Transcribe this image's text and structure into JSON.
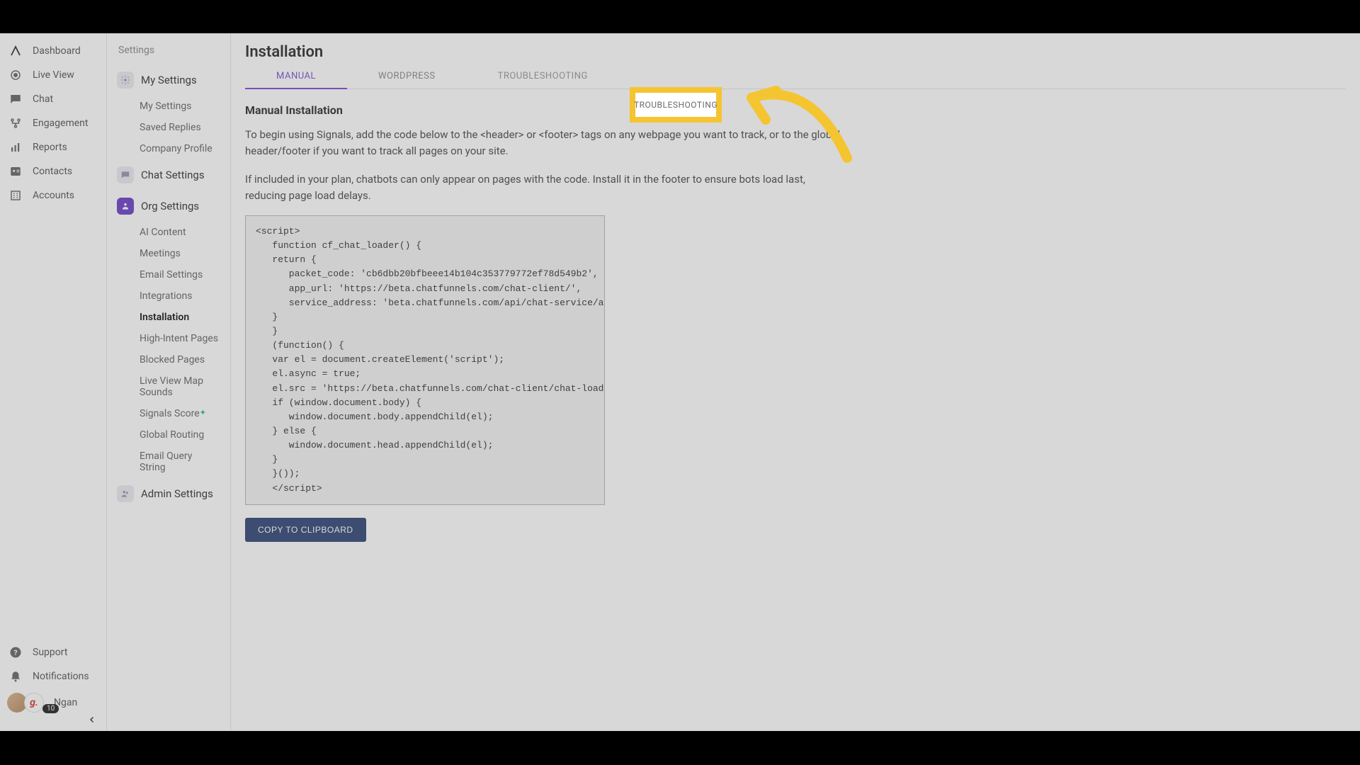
{
  "left_nav": {
    "items": [
      {
        "label": "Dashboard"
      },
      {
        "label": "Live View"
      },
      {
        "label": "Chat"
      },
      {
        "label": "Engagement"
      },
      {
        "label": "Reports"
      },
      {
        "label": "Contacts"
      },
      {
        "label": "Accounts"
      }
    ],
    "support": "Support",
    "notifications": "Notifications",
    "user_name": "Ngan",
    "badge_count": "10",
    "avatar_initial": "g."
  },
  "settings": {
    "panel_title": "Settings",
    "sections": {
      "my_settings": {
        "label": "My Settings",
        "items": [
          "My Settings",
          "Saved Replies",
          "Company Profile"
        ]
      },
      "chat_settings": {
        "label": "Chat Settings"
      },
      "org_settings": {
        "label": "Org Settings",
        "items": [
          "AI Content",
          "Meetings",
          "Email Settings",
          "Integrations",
          "Installation",
          "High-Intent Pages",
          "Blocked Pages",
          "Live View Map Sounds",
          "Signals Score",
          "Global Routing",
          "Email Query String"
        ]
      },
      "admin_settings": {
        "label": "Admin Settings"
      }
    },
    "active_item": "Installation",
    "star_item": "Signals Score"
  },
  "main": {
    "title": "Installation",
    "tabs": [
      "MANUAL",
      "WORDPRESS",
      "TROUBLESHOOTING"
    ],
    "active_tab": "MANUAL",
    "highlighted_tab": "TROUBLESHOOTING",
    "section_heading": "Manual Installation",
    "paragraph1": "To begin using Signals, add the code below to the <header> or <footer> tags on any webpage you want to track, or to the global header/footer if you want to track all pages on your site.",
    "paragraph2": "If included in your plan, chatbots can only appear on pages with the code. Install it in the footer to ensure bots load last, reducing page load delays.",
    "code": "<script>\n   function cf_chat_loader() {\n   return {\n      packet_code: 'cb6dbb20bfbeee14b104c353779772ef78d549b2',\n      app_url: 'https://beta.chatfunnels.com/chat-client/',\n      service_address: 'beta.chatfunnels.com/api/chat-service/a'\n   }\n   }\n   (function() {\n   var el = document.createElement('script');\n   el.async = true;\n   el.src = 'https://beta.chatfunnels.com/chat-client/chat-loader.js';\n   if (window.document.body) {\n      window.document.body.appendChild(el);\n   } else {\n      window.document.head.appendChild(el);\n   }\n   }());\n   </script>",
    "copy_button": "COPY TO CLIPBOARD"
  },
  "annotation": {
    "arrow_color": "#f5c431"
  }
}
